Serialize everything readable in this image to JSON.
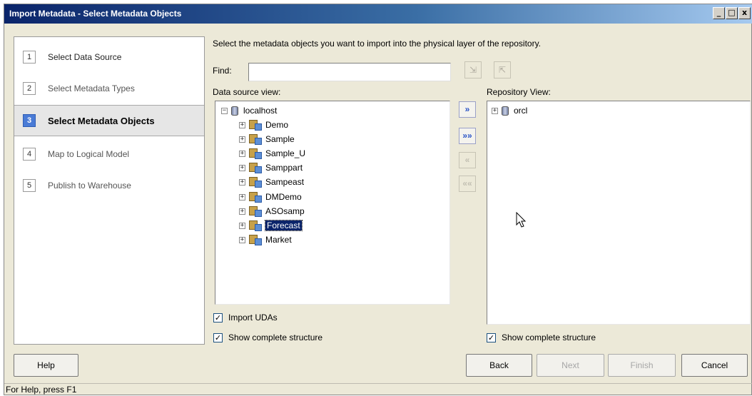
{
  "window": {
    "title": "Import Metadata - Select Metadata Objects",
    "controls": [
      "_",
      "□",
      "x"
    ]
  },
  "steps": [
    {
      "num": "1",
      "label": "Select Data Source"
    },
    {
      "num": "2",
      "label": "Select Metadata Types"
    },
    {
      "num": "3",
      "label": "Select Metadata Objects"
    },
    {
      "num": "4",
      "label": "Map to Logical Model"
    },
    {
      "num": "5",
      "label": "Publish to Warehouse"
    }
  ],
  "main": {
    "instruction": "Select the metadata objects you want to import into the physical layer of the repository.",
    "find_label": "Find:",
    "find_value": "",
    "data_source_label": "Data source view:",
    "repository_label": "Repository View:"
  },
  "data_source_tree": {
    "root": "localhost",
    "children": [
      "Demo",
      "Sample",
      "Sample_U",
      "Samppart",
      "Sampeast",
      "DMDemo",
      "ASOsamp",
      "Forecast",
      "Market"
    ],
    "selected": "Forecast"
  },
  "repository_tree": {
    "root": "orcl"
  },
  "options": {
    "import_udas": "Import UDAs",
    "show_complete_left": "Show complete structure",
    "show_complete_right": "Show complete structure"
  },
  "buttons": {
    "help": "Help",
    "back": "Back",
    "next": "Next",
    "finish": "Finish",
    "cancel": "Cancel"
  },
  "status": "For Help, press F1",
  "colors": {
    "selection": "#0a246a",
    "active_step": "#4a7bd6"
  }
}
